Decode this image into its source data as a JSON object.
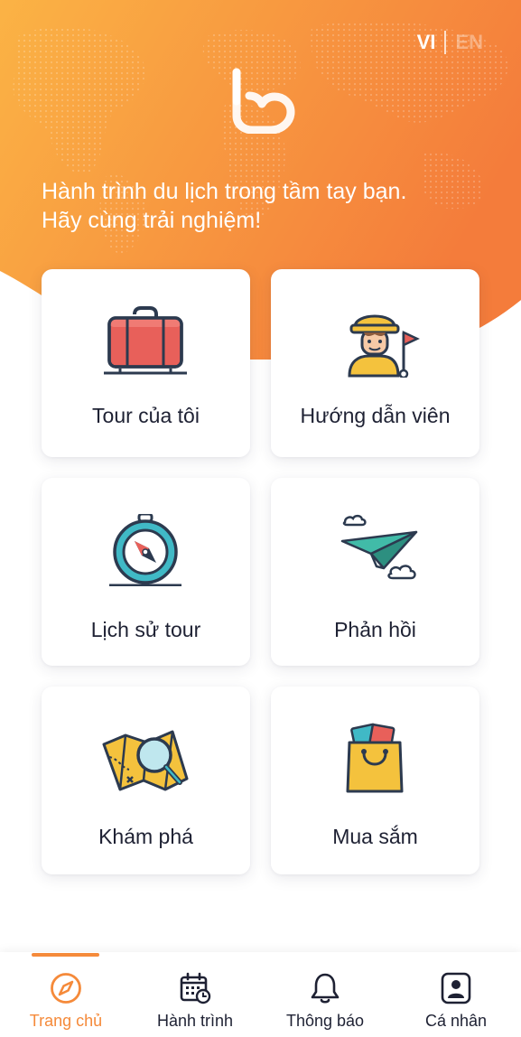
{
  "header": {
    "lang_vi": "VI",
    "lang_en": "EN",
    "tagline_line1": "Hành trình du lịch trong tầm tay bạn.",
    "tagline_line2": "Hãy cùng trải nghiệm!",
    "colors": {
      "gradient_start": "#fbb345",
      "gradient_end": "#f47c3b"
    }
  },
  "cards": [
    {
      "label": "Tour của tôi",
      "icon": "suitcase-icon"
    },
    {
      "label": "Hướng dẫn viên",
      "icon": "tour-guide-icon"
    },
    {
      "label": "Lịch sử tour",
      "icon": "compass-icon"
    },
    {
      "label": "Phản hồi",
      "icon": "paper-plane-icon"
    },
    {
      "label": "Khám phá",
      "icon": "map-search-icon"
    },
    {
      "label": "Mua sắm",
      "icon": "shopping-bag-icon"
    }
  ],
  "nav": {
    "items": [
      {
        "label": "Trang chủ",
        "icon": "compass-nav-icon",
        "active": true
      },
      {
        "label": "Hành trình",
        "icon": "calendar-icon",
        "active": false
      },
      {
        "label": "Thông báo",
        "icon": "bell-icon",
        "active": false
      },
      {
        "label": "Cá nhân",
        "icon": "profile-icon",
        "active": false
      }
    ],
    "active_color": "#f58a3a"
  }
}
